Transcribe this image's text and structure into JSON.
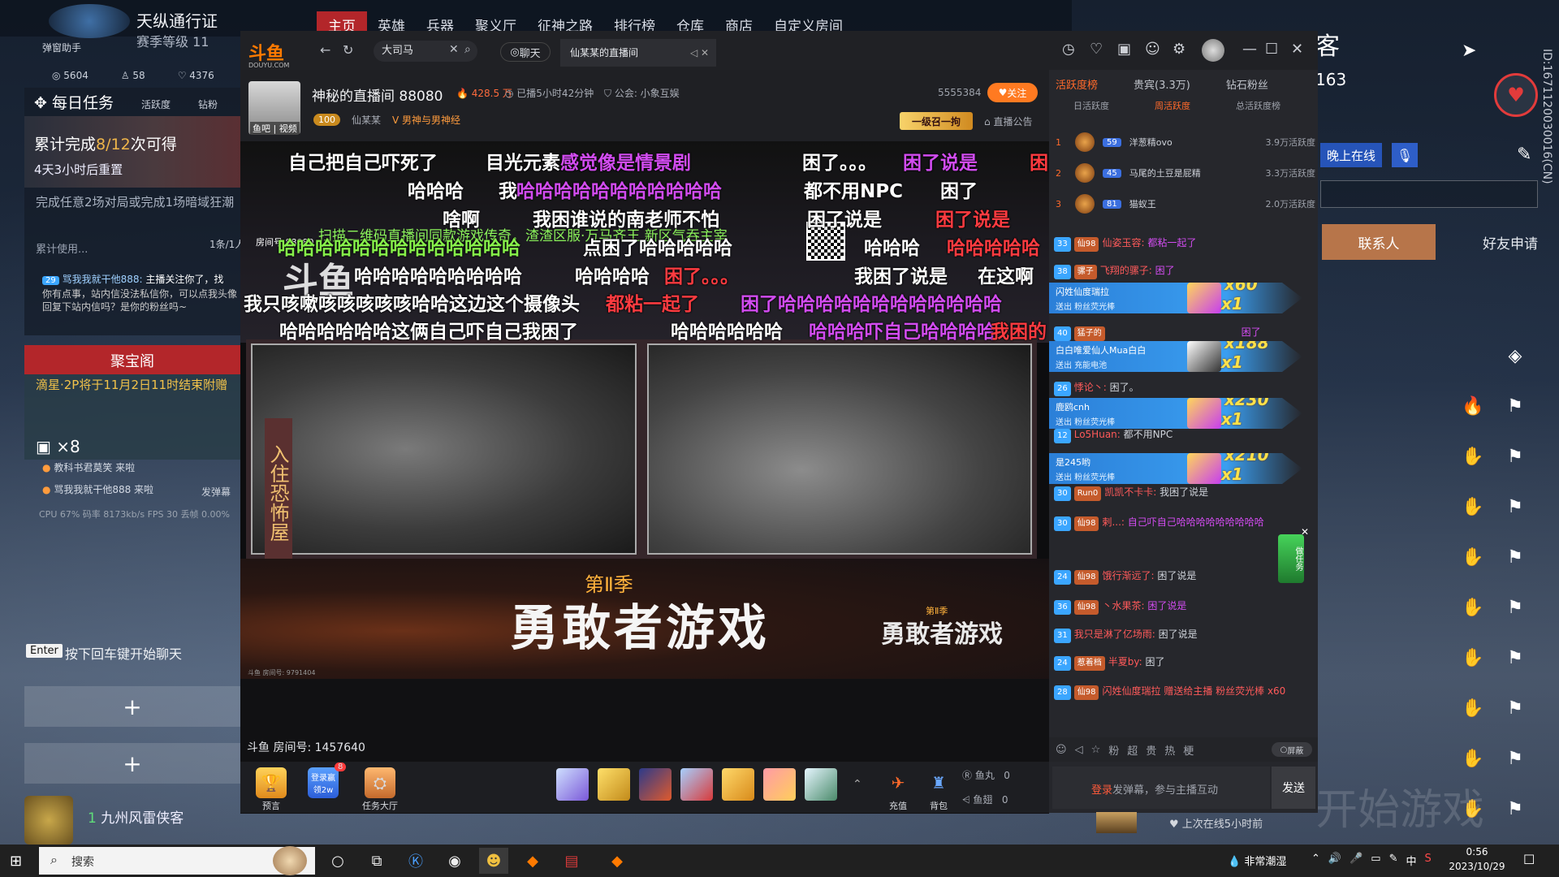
{
  "game": {
    "season_title": "天纵通行证",
    "season_level": "赛季等级 11",
    "helper": "弹窗助手",
    "stats": [
      "5604",
      "58",
      "4376"
    ],
    "nav": [
      "主页",
      "英雄",
      "兵器",
      "聚义厅",
      "征神之路",
      "排行榜",
      "仓库",
      "商店",
      "自定义房间"
    ],
    "daily": {
      "title": "每日任务",
      "tabs": [
        "活跃度",
        "钻粉"
      ],
      "progress_prefix": "累计完成",
      "progress_value": "8/12",
      "progress_suffix": "次可得",
      "reset": "4天3小时后重置",
      "task1": "完成任意2场对局或完成1场暗域狂潮",
      "task2": "累计使用...",
      "page": "1条/1人"
    },
    "chat_preview": {
      "badge": "29",
      "name": "骂我我就干他888:",
      "line1": "主播关注你了，找",
      "line2": "你有点事，站内信没法私信你，可以点我头像",
      "line3": "回复下站内信吗？是你的粉丝吗~"
    },
    "treasure": {
      "title": "聚宝阁",
      "notice": "滴星·2P将于11月2日11时结束附赠",
      "count": "×8"
    },
    "visitors": [
      "教科书君莫笑 来啦",
      "骂我我就干他888 来啦"
    ],
    "danmu_btn": "发弹幕",
    "perf": "CPU 67%  码率 8173kb/s  FPS 30  丢帧 0.00%",
    "enter_key": "Enter",
    "enter_hint": "按下回车键开始聊天",
    "plus": "+",
    "player_name": "九州风雷侠客",
    "player_rank": "1",
    "guest_title": "客",
    "guest_num": "163",
    "online_btn": "晚上在线",
    "contact_tab": "联系人",
    "friend_tab": "好友申请",
    "id_text": "ID:1671120030016(CN)",
    "start_game": "开始游戏"
  },
  "douyu": {
    "logo": "斗鱼",
    "logo_sub": "DOUYU.COM",
    "search_value": "大司马",
    "chat_tab": "聊天",
    "live_tab": "仙某某的直播间",
    "streamer": {
      "room_title": "神秘的直播间 88080",
      "hot": "428.5 万",
      "live_time": "已播5小时42分钟",
      "guild": "公会: 小象互娱",
      "avatar_label": "鱼吧 | 视频",
      "level": "100",
      "name": "仙某某",
      "category": "男神与男神经",
      "follow_count": "5555384",
      "follow_btn": "关注",
      "summon": "一级召一拘",
      "notice": "直播公告"
    },
    "video": {
      "scan_text": "扫描二维码直播间同款游戏传奇，渣渣区服·万马齐王 新区气吞主宰",
      "watermark": "斗鱼",
      "room_watermark": "房间号 88080",
      "cam1_label": "入住恐怖屋",
      "season_badge": "第Ⅱ季",
      "game_title": "勇敢者游戏",
      "season_badge2": "第Ⅱ季",
      "game_title2": "勇敢者游戏",
      "room_tiny": "斗鱼 房间号: 9791404"
    },
    "danmu": [
      {
        "t": "自己把自己吓死了",
        "c": "w"
      },
      {
        "t": "目光元素",
        "c": "w"
      },
      {
        "t": "感觉像是情景剧",
        "c": "p"
      },
      {
        "t": "困了。。。",
        "c": "w"
      },
      {
        "t": "困了说是",
        "c": "p"
      },
      {
        "t": "困",
        "c": "r"
      },
      {
        "t": "哈哈哈",
        "c": "w"
      },
      {
        "t": "我",
        "c": "w"
      },
      {
        "t": "哈哈哈哈哈哈哈哈哈哈哈",
        "c": "p"
      },
      {
        "t": "都不用NPC",
        "c": "w"
      },
      {
        "t": "困了",
        "c": "w"
      },
      {
        "t": "啥啊",
        "c": "w"
      },
      {
        "t": "我困谁说的南老师不怕",
        "c": "w"
      },
      {
        "t": "困了说是",
        "c": "w"
      },
      {
        "t": "困了说是",
        "c": "r"
      },
      {
        "t": "哈哈哈哈哈哈哈哈哈哈哈哈哈",
        "c": "g"
      },
      {
        "t": "点困了哈哈哈哈哈",
        "c": "w"
      },
      {
        "t": "哈哈哈",
        "c": "w"
      },
      {
        "t": "哈哈哈哈哈",
        "c": "r"
      },
      {
        "t": "哈哈哈哈哈哈哈哈哈",
        "c": "w"
      },
      {
        "t": "哈哈哈哈",
        "c": "w"
      },
      {
        "t": "困了。。。",
        "c": "r"
      },
      {
        "t": "我困了说是",
        "c": "w"
      },
      {
        "t": "在这啊",
        "c": "w"
      },
      {
        "t": "我只咳嗽咳咳咳咳咳哈哈这边这个摄像头",
        "c": "w"
      },
      {
        "t": "都粘一起了",
        "c": "r"
      },
      {
        "t": "困了哈哈哈哈哈哈哈哈哈哈哈哈",
        "c": "p"
      },
      {
        "t": "哈哈哈哈哈哈这俩自己吓自己我困了",
        "c": "w"
      },
      {
        "t": "哈哈哈哈哈哈",
        "c": "w"
      },
      {
        "t": "哈哈哈吓自己哈哈哈哈",
        "c": "p"
      },
      {
        "t": "我困的",
        "c": "r"
      }
    ],
    "room_number": "斗鱼 房间号: 1457640",
    "toolbar": {
      "predict": "预言",
      "signin": "登录赢领2w",
      "signin_badge": "8",
      "task_hall": "任务大厅",
      "recharge": "充值",
      "backpack": "背包",
      "fish_balls": "鱼丸",
      "fish_balls_val": "0",
      "fish_fins": "鱼翅",
      "fish_fins_val": "0"
    },
    "ranks": {
      "tabs": [
        "活跃度榜",
        "贵宾(3.3万)",
        "钻石粉丝"
      ],
      "sub": [
        "日活跃度",
        "周活跃度",
        "总活跃度榜"
      ],
      "rows": [
        {
          "num": "1",
          "lv": "59",
          "name": "洋葱精ovo",
          "score": "3.9万活跃度"
        },
        {
          "num": "2",
          "lv": "45",
          "name": "马尾的土豆是屁精",
          "score": "3.3万活跃度"
        },
        {
          "num": "3",
          "lv": "81",
          "name": "猫蚁王",
          "score": "2.0万活跃度"
        }
      ]
    },
    "chat": [
      {
        "lv": "33",
        "fan": "仙98",
        "name": "仙姿玉容:",
        "text": "都粘一起了",
        "p": true
      },
      {
        "lv": "38",
        "fan": "骡子",
        "name": "飞翔的骡子:",
        "text": "困了",
        "p": true
      },
      {
        "lv": "40",
        "fan": "猛子的",
        "name": "",
        "text": "困了",
        "p": true
      },
      {
        "lv": "26",
        "fan": "",
        "name": "悸论丶:",
        "text": "困了。",
        "p": false
      },
      {
        "lv": "12",
        "fan": "",
        "name": "Lo5Huan:",
        "text": "都不用NPC",
        "p": false
      },
      {
        "lv": "30",
        "fan": "Run0",
        "name": "凯凯不卡卡:",
        "text": "我困了说是",
        "p": false
      },
      {
        "lv": "30",
        "fan": "仙98",
        "name": "剌...:",
        "text": "自己吓自己哈哈哈哈哈哈哈哈哈",
        "p": true
      },
      {
        "lv": "24",
        "fan": "仙98",
        "name": "饿行渐远了:",
        "text": "困了说是",
        "p": false
      },
      {
        "lv": "36",
        "fan": "仙98",
        "name": "丶水果茶:",
        "text": "困了说是",
        "p": true
      },
      {
        "lv": "31",
        "fan": "",
        "name": "我只是淋了亿场雨:",
        "text": "困了说是",
        "p": false
      },
      {
        "lv": "24",
        "fan": "惹着档",
        "name": "半夏by:",
        "text": "困了",
        "p": false
      },
      {
        "lv": "28",
        "fan": "仙98",
        "name": "闪姓仙度瑞拉",
        "text": "赠送给主播 粉丝荧光棒 x60",
        "p": false
      }
    ],
    "gifts": [
      {
        "name": "闪姓仙度瑞拉",
        "send": "送出  粉丝荧光棒",
        "count": "x60",
        "x1": "x1"
      },
      {
        "name": "白白唯爱仙人Mua白白",
        "send": "送出  充能电池",
        "count": "x188",
        "x1": "x1"
      },
      {
        "name": "鹿鸥cnh",
        "send": "送出  粉丝荧光棒",
        "count": "x230",
        "x1": "x1"
      },
      {
        "name": "是245哟",
        "send": "送出  粉丝荧光棒",
        "count": "x210",
        "x1": "x1"
      }
    ],
    "chat_tools": [
      "☺",
      "◁",
      "☆",
      "粉",
      "超",
      "贵",
      "热",
      "梗"
    ],
    "shield": "屏蔽",
    "input_login": "登录",
    "input_text": "发弹幕，参与主播互动",
    "send": "发送",
    "last_online": "上次在线5小时前",
    "task_ad": "做任务"
  },
  "taskbar": {
    "search": "搜索",
    "weather": "非常潮湿",
    "time": "0:56",
    "date": "2023/10/29",
    "ime": "中"
  },
  "colors": {
    "douyu_orange": "#ff7a00",
    "accent_red": "#b3262a",
    "danmu_purple": "#d24cf0",
    "danmu_red": "#ff3b40",
    "danmu_green": "#86f04a"
  }
}
